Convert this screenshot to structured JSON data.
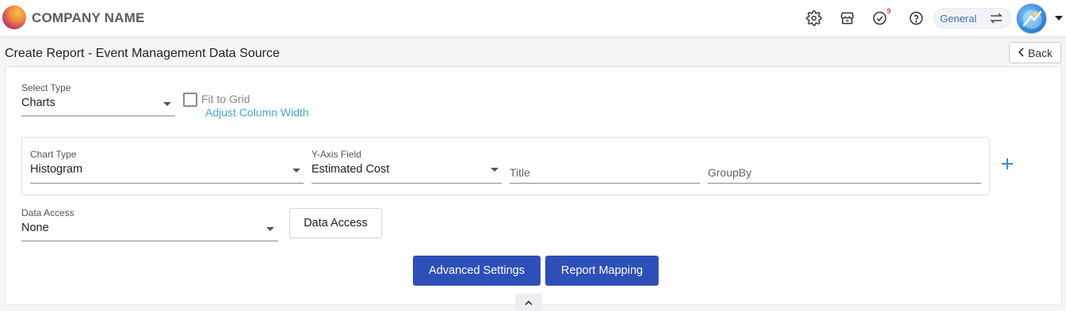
{
  "header": {
    "brand": "COMPANY NAME",
    "notification_count": "9",
    "environment": "General",
    "icons": [
      "settings-icon",
      "store-icon",
      "tasks-check-icon",
      "help-icon",
      "swap-icon"
    ]
  },
  "page": {
    "title": "Create Report - Event Management Data Source",
    "back_label": "Back"
  },
  "form": {
    "select_type": {
      "label": "Select Type",
      "value": "Charts"
    },
    "fit_to_grid": {
      "label": "Fit to Grid",
      "checked": false
    },
    "adjust_link": "Adjust Column Width",
    "chart_type": {
      "label": "Chart Type",
      "value": "Histogram"
    },
    "y_axis": {
      "label": "Y-Axis Field",
      "value": "Estimated Cost"
    },
    "title_field": {
      "placeholder": "Title"
    },
    "groupby_field": {
      "placeholder": "GroupBy"
    },
    "data_access": {
      "label": "Data Access",
      "value": "None"
    },
    "data_access_button": "Data Access",
    "advanced_settings": "Advanced Settings",
    "report_mapping": "Report Mapping"
  },
  "colors": {
    "primary": "#2d4fb8",
    "link": "#40a8e0",
    "badge": "#e53935"
  }
}
